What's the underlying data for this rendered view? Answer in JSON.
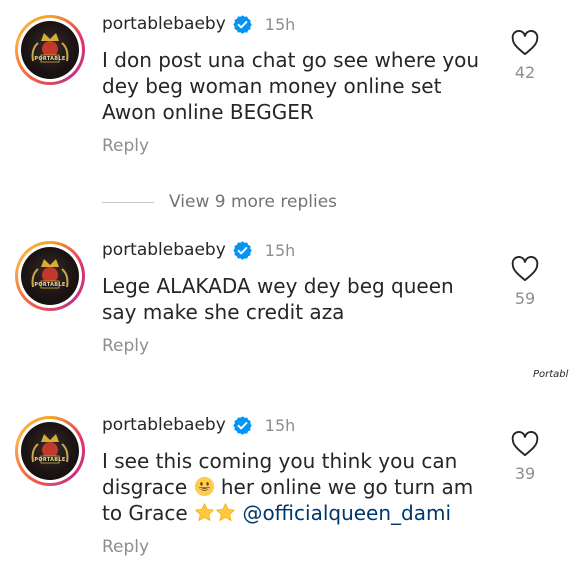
{
  "comments": [
    {
      "username": "portablebaeby",
      "time": "15h",
      "text": "I don post una chat go see where you dey beg woman money online set Awon online BEGGER",
      "reply_label": "Reply",
      "likes": "42"
    },
    {
      "username": "portablebaeby",
      "time": "15h",
      "text": "Lege ALAKADA wey dey beg queen say make she credit aza",
      "reply_label": "Reply",
      "likes": "59"
    },
    {
      "username": "portablebaeby",
      "time": "15h",
      "text_part1": "I see this coming you think you can disgrace",
      "emoji1": "grinning-face",
      "text_part2": "her online we go turn am to Grace",
      "emoji2": "star",
      "mention": "@officialqueen_dami",
      "reply_label": "Reply",
      "likes": "39"
    }
  ],
  "view_more_label": "View 9 more replies",
  "side_label": "Portabl",
  "avatar_text": "PORTABLE",
  "icons": {
    "verified": "verified-badge-icon",
    "like": "heart-outline-icon"
  },
  "colors": {
    "verified": "#0095f6",
    "secondary_text": "#8e8e8e",
    "mention": "#00376b"
  }
}
